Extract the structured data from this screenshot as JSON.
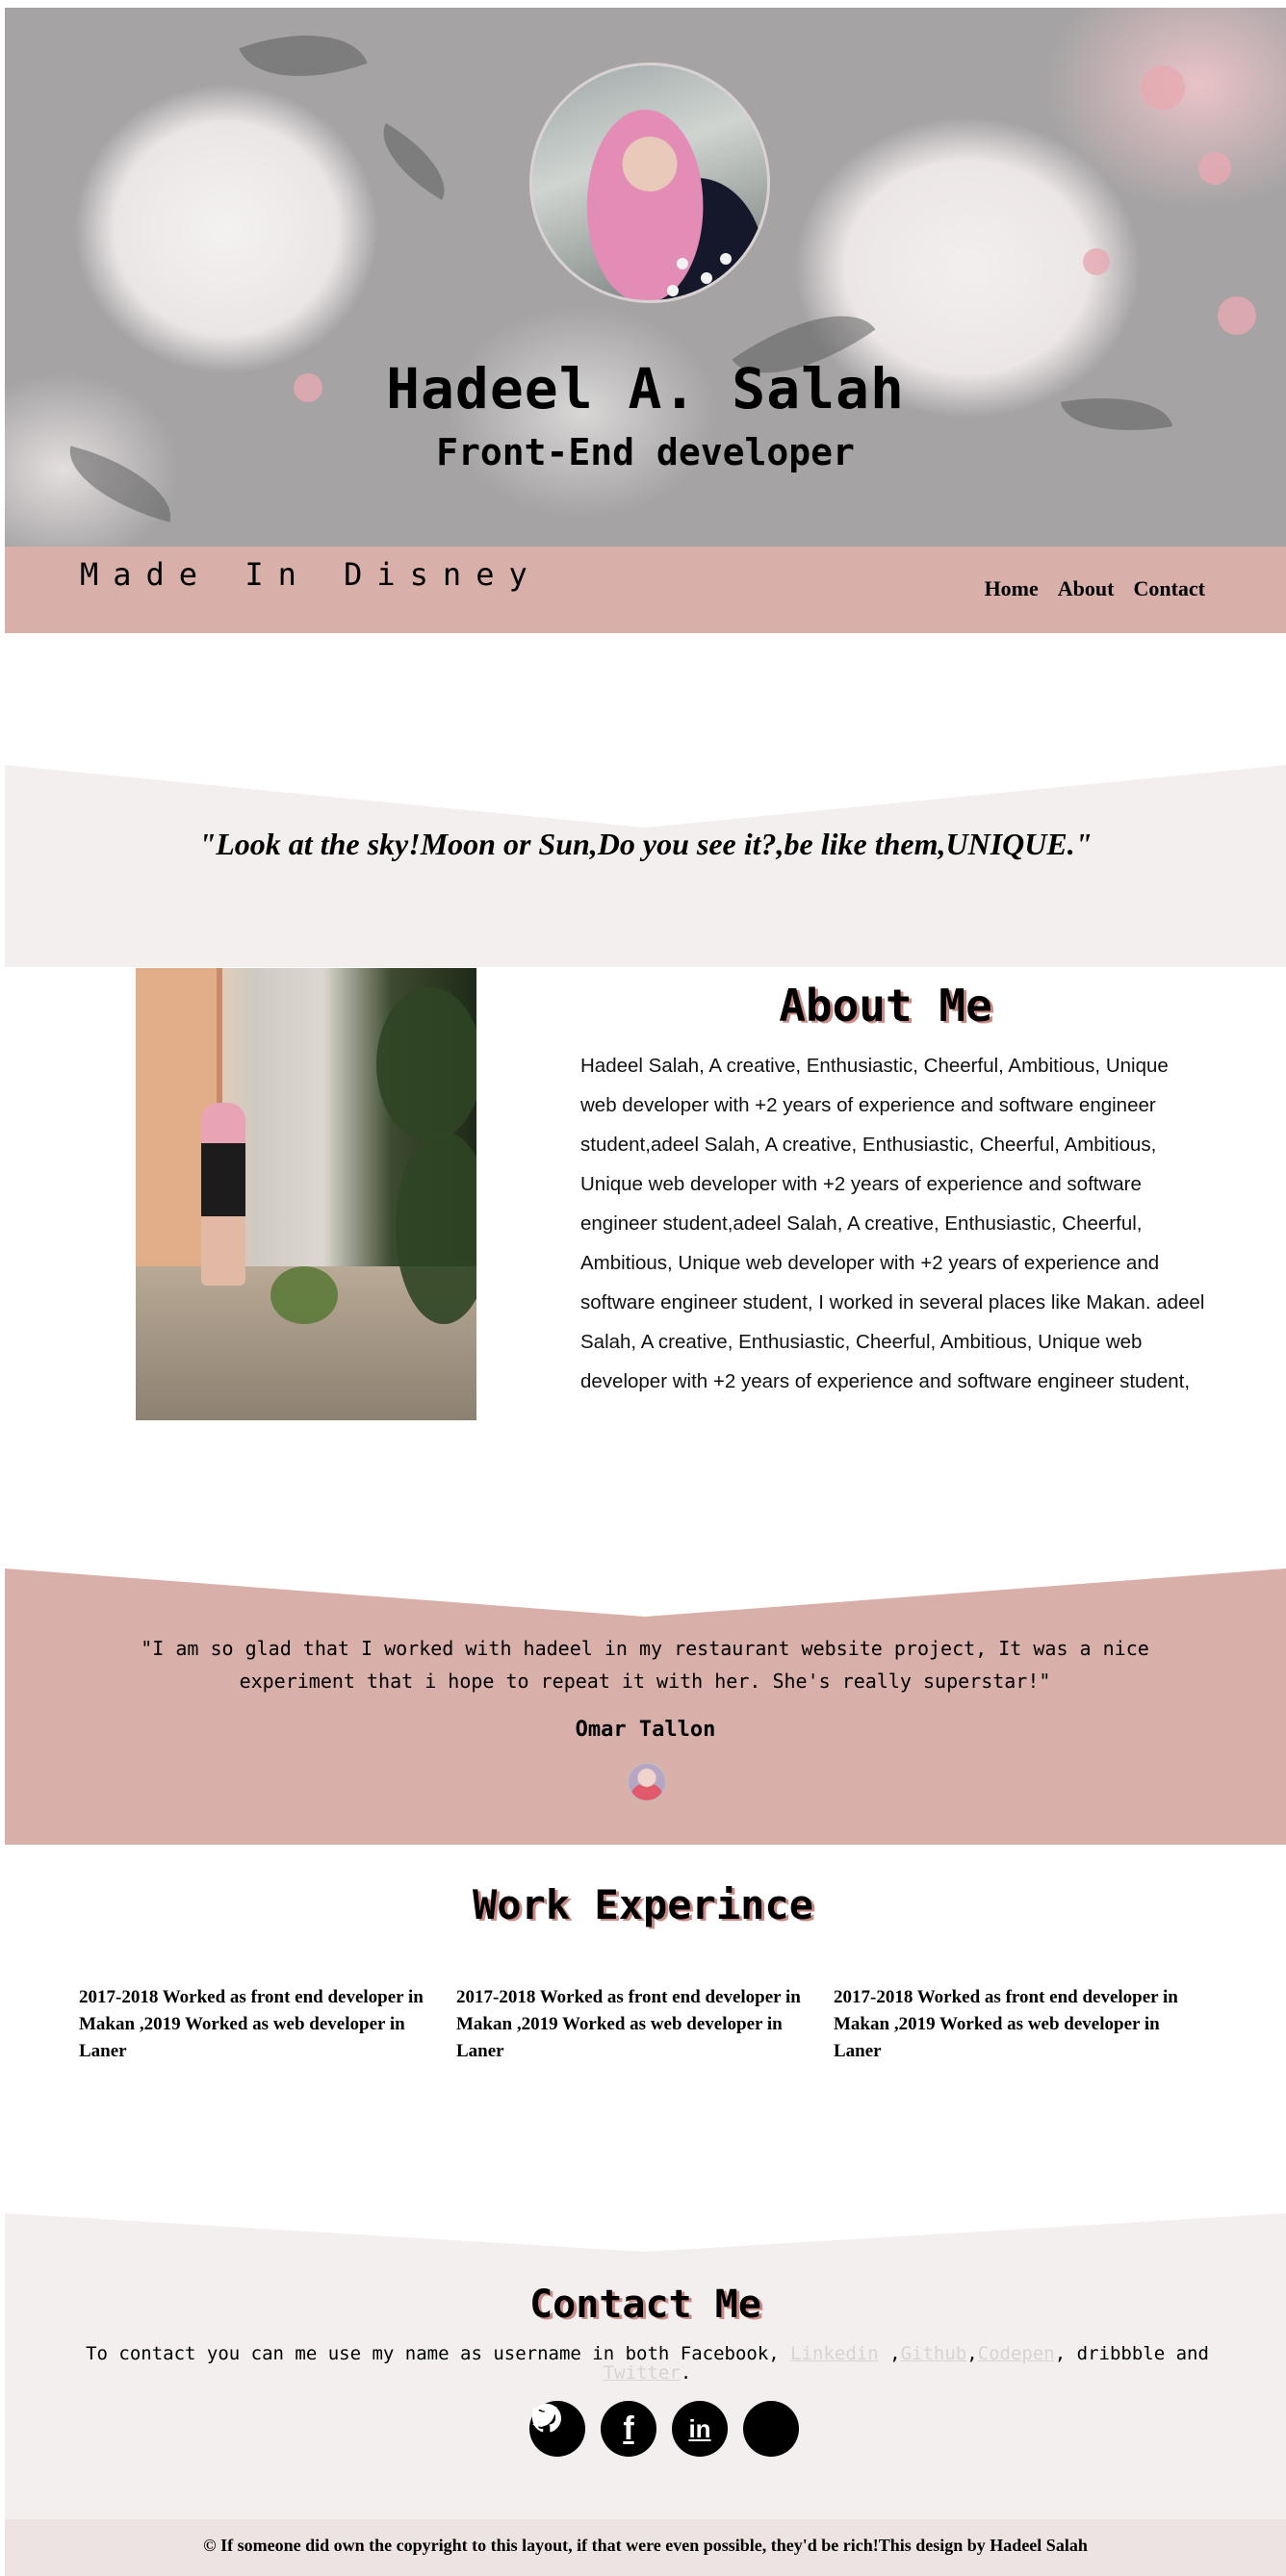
{
  "hero": {
    "name": "Hadeel A. Salah",
    "role": "Front-End developer"
  },
  "navbar": {
    "brand": "Made In Disney",
    "links": [
      "Home",
      "About",
      "Contact"
    ]
  },
  "quote": {
    "text": "\"Look at the sky!Moon or Sun,Do you see it?,be like them,UNIQUE.\""
  },
  "about": {
    "title": "About Me",
    "text": "Hadeel Salah, A creative, Enthusiastic, Cheerful, Ambitious, Unique web developer with +2 years of experience and software engineer student,adeel Salah, A creative, Enthusiastic, Cheerful, Ambitious, Unique web developer with +2 years of experience and software engineer student,adeel Salah, A creative, Enthusiastic, Cheerful, Ambitious, Unique web developer with +2 years of experience and software engineer student, I worked in several places like Makan. adeel Salah, A creative, Enthusiastic, Cheerful, Ambitious, Unique web developer with +2 years of experience and software engineer student,"
  },
  "testimonial": {
    "text": "\"I am so glad that I worked with hadeel in my restaurant website project, It was a nice experiment that i hope to repeat it with her. She's really superstar!\"",
    "author": "Omar Tallon"
  },
  "work": {
    "title": "Work Experince",
    "items": [
      "2017-2018 Worked as front end developer in Makan ,2019 Worked as web developer in Laner",
      "2017-2018 Worked as front end developer in Makan ,2019 Worked as web developer in Laner",
      "2017-2018 Worked as front end developer in Makan ,2019 Worked as web developer in Laner"
    ]
  },
  "contact": {
    "title": "Contact Me",
    "intro": "To contact you can me use my name as username in both Facebook, ",
    "linkedin": "Linkedin",
    "sep1": " ,",
    "github": "Github",
    "sep2": ",",
    "codepen": "Codepen",
    "middle": ", dribbble and ",
    "twitter": "Twitter",
    "end": ".",
    "social_icons": [
      "github-icon",
      "facebook-icon",
      "linkedin-icon",
      "twitter-icon"
    ],
    "social_glyphs": {
      "facebook": "f",
      "linkedin": "in"
    }
  },
  "footer": {
    "text": "© If someone did own the copyright to this layout, if that were even possible, they'd be rich!This design by Hadeel Salah"
  },
  "colors": {
    "accent_pink": "#d8afa9",
    "light_band": "#f3efee",
    "footer_bg": "#ede3e3",
    "title_shadow": "#c98a84"
  }
}
